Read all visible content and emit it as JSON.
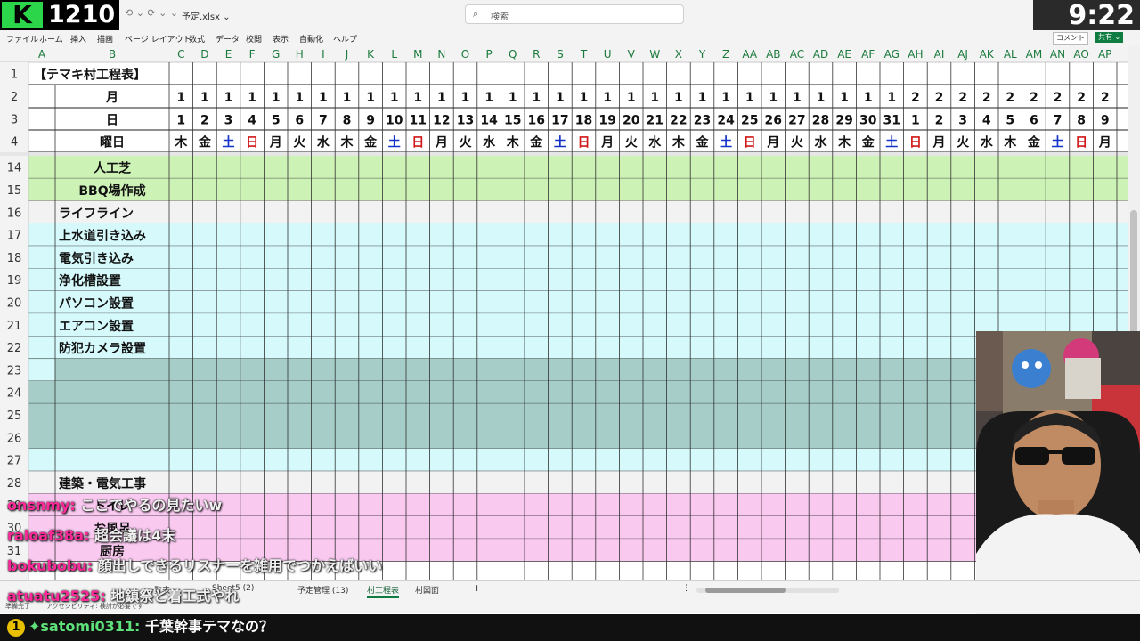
{
  "stream": {
    "viewer_count": "1210",
    "clock": "9:22"
  },
  "app": {
    "qat": "⟲ ⌄  ⟳ ⌄   ⌄",
    "filename": "予定.xlsx ⌄",
    "search_placeholder": "検索",
    "comment_label": "コメント",
    "share_label": "共有 ⌄",
    "menu": [
      "ファイル",
      "ホーム",
      "挿入",
      "描画",
      "ページ レイアウト",
      "数式",
      "データ",
      "校閲",
      "表示",
      "自動化",
      "ヘルプ"
    ]
  },
  "sheet": {
    "title": "【テマキ村工程表】",
    "columns": [
      "A",
      "B",
      "C",
      "D",
      "E",
      "F",
      "G",
      "H",
      "I",
      "J",
      "K",
      "L",
      "M",
      "N",
      "O",
      "P",
      "Q",
      "R",
      "S",
      "T",
      "U",
      "V",
      "W",
      "X",
      "Y",
      "Z",
      "AA",
      "AB",
      "AC",
      "AD",
      "AE",
      "AF",
      "AG",
      "AH",
      "AI",
      "AJ",
      "AK",
      "AL",
      "AM",
      "AN",
      "AO",
      "AP"
    ],
    "header_rows": {
      "month_label": "月",
      "day_label": "日",
      "weekday_label": "曜日",
      "months": [
        1,
        1,
        1,
        1,
        1,
        1,
        1,
        1,
        1,
        1,
        1,
        1,
        1,
        1,
        1,
        1,
        1,
        1,
        1,
        1,
        1,
        1,
        1,
        1,
        1,
        1,
        1,
        1,
        1,
        1,
        1,
        2,
        2,
        2,
        2,
        2,
        2,
        2,
        2,
        2
      ],
      "days": [
        1,
        2,
        3,
        4,
        5,
        6,
        7,
        8,
        9,
        10,
        11,
        12,
        13,
        14,
        15,
        16,
        17,
        18,
        19,
        20,
        21,
        22,
        23,
        24,
        25,
        26,
        27,
        28,
        29,
        30,
        31,
        1,
        2,
        3,
        4,
        5,
        6,
        7,
        8,
        9
      ],
      "weekdays": [
        "木",
        "金",
        "土",
        "日",
        "月",
        "火",
        "水",
        "木",
        "金",
        "土",
        "日",
        "月",
        "火",
        "水",
        "木",
        "金",
        "土",
        "日",
        "月",
        "火",
        "水",
        "木",
        "金",
        "土",
        "日",
        "月",
        "火",
        "水",
        "木",
        "金",
        "土",
        "日",
        "月",
        "火",
        "水",
        "木",
        "金",
        "土",
        "日",
        "月"
      ]
    },
    "rows": [
      {
        "num": "14",
        "label": "人工芝",
        "align": "center",
        "fill": "#cdf2b6"
      },
      {
        "num": "15",
        "label": "BBQ場作成",
        "align": "center",
        "fill": "#cdf2b6"
      },
      {
        "num": "16",
        "label": "ライフライン",
        "align": "left",
        "fill": "#f2f2f2"
      },
      {
        "num": "17",
        "label": "上水道引き込み",
        "align": "left",
        "fill": "#d6fafc"
      },
      {
        "num": "18",
        "label": "電気引き込み",
        "align": "left",
        "fill": "#d6fafc"
      },
      {
        "num": "19",
        "label": "浄化槽設置",
        "align": "left",
        "fill": "#d6fafc"
      },
      {
        "num": "20",
        "label": "パソコン設置",
        "align": "left",
        "fill": "#d6fafc"
      },
      {
        "num": "21",
        "label": "エアコン設置",
        "align": "left",
        "fill": "#d6fafc"
      },
      {
        "num": "22",
        "label": "防犯カメラ設置",
        "align": "left",
        "fill": "#d6fafc"
      },
      {
        "num": "23",
        "label": "",
        "align": "left",
        "fill": "#a6cdc8"
      },
      {
        "num": "24",
        "label": "",
        "align": "left",
        "fill": "#a6cdc8"
      },
      {
        "num": "25",
        "label": "",
        "align": "left",
        "fill": "#a6cdc8"
      },
      {
        "num": "26",
        "label": "",
        "align": "left",
        "fill": "#a6cdc8"
      },
      {
        "num": "27",
        "label": "",
        "align": "left",
        "fill": "#d6fafc"
      },
      {
        "num": "28",
        "label": "建築・電気工事",
        "align": "left",
        "fill": "#f2f2f2"
      },
      {
        "num": "29",
        "label": "トイレ",
        "align": "center",
        "fill": "#f9c9f0"
      },
      {
        "num": "30",
        "label": "お風呂",
        "align": "center",
        "fill": "#f9c9f0"
      },
      {
        "num": "31",
        "label": "厨房",
        "align": "center",
        "fill": "#f9c9f0"
      }
    ]
  },
  "tabs": {
    "partial": "一覧表",
    "items": [
      "Sheet5 (2)",
      "予定管理 (13)",
      "村工程表",
      "村図面"
    ],
    "active": "村工程表",
    "add": "+",
    "more": "⋮"
  },
  "status": {
    "ready": "準備完了",
    "accessibility": "アクセシビリティ: 検討が必要です"
  },
  "colors": {
    "excel_green": "#107c41",
    "weekend_blue": "#1533c8",
    "weekend_red": "#d01818"
  },
  "chat": [
    {
      "user": "onsnmy:",
      "text": "ここでやるの見たいw"
    },
    {
      "user": "raloaf38a:",
      "text": "超会議は4末"
    },
    {
      "user": "bokubobu:",
      "text": "顔出しできるリスナーを雑用でつかえばいい"
    },
    {
      "user": "atuatu2525:",
      "text": "地鎮祭と着工式やれ"
    }
  ],
  "chat_highlight": {
    "badge": "1",
    "icon": "✦",
    "user": "satomi0311:",
    "text": "千葉幹事テマなの？"
  }
}
